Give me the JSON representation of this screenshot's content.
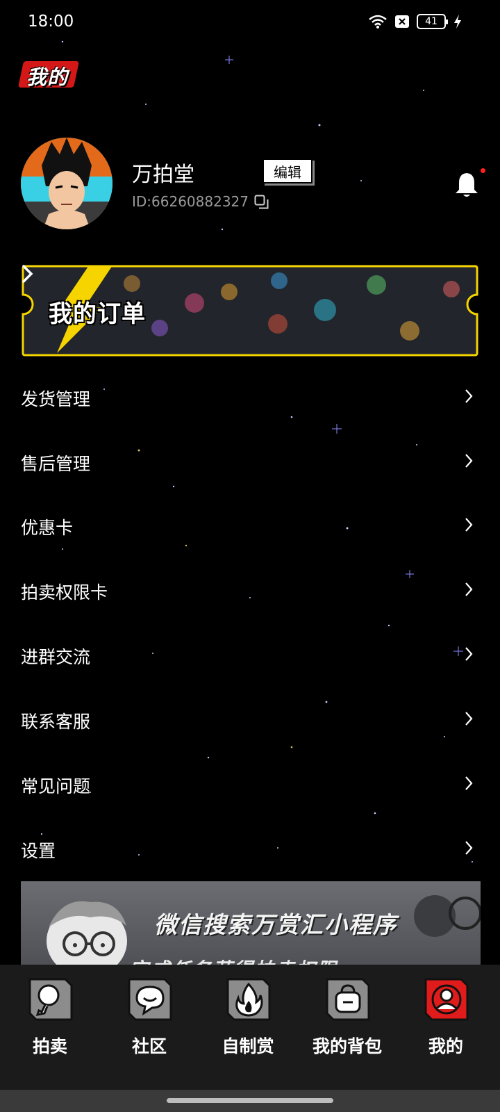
{
  "status_bar": {
    "time": "18:00",
    "battery": "41"
  },
  "header": {
    "title": "我的"
  },
  "profile": {
    "name": "万拍堂",
    "edit_label": "编辑",
    "id_text": "ID:66260882327"
  },
  "order_card": {
    "title": "我的订单"
  },
  "menu": {
    "items": [
      {
        "label": "发货管理"
      },
      {
        "label": "售后管理"
      },
      {
        "label": "优惠卡"
      },
      {
        "label": "拍卖权限卡"
      },
      {
        "label": "进群交流"
      },
      {
        "label": "联系客服"
      },
      {
        "label": "常见问题"
      },
      {
        "label": "设置"
      }
    ]
  },
  "promo": {
    "title": "微信搜索万赏汇小程序",
    "subtitle": "完成任务获得拍卖权限"
  },
  "tabs": [
    {
      "label": "拍卖",
      "icon": "chicken-leg-icon"
    },
    {
      "label": "社区",
      "icon": "chat-bubble-icon"
    },
    {
      "label": "自制赏",
      "icon": "flame-icon"
    },
    {
      "label": "我的背包",
      "icon": "backpack-icon"
    },
    {
      "label": "我的",
      "icon": "user-icon",
      "active": true
    }
  ],
  "colors": {
    "accent_red": "#e01b1b",
    "border_yellow": "#f5d400",
    "background": "#000000"
  }
}
